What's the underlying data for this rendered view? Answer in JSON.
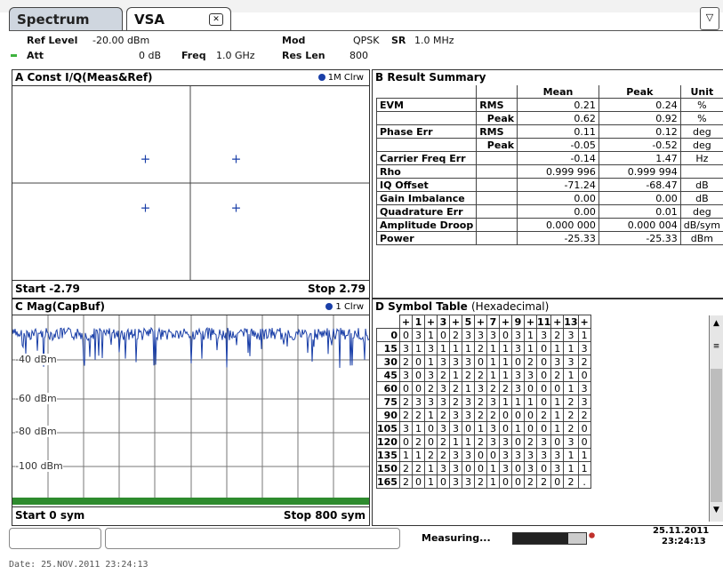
{
  "tabs": {
    "spectrum": "Spectrum",
    "vsa": "VSA"
  },
  "header": {
    "ref_level_label": "Ref Level",
    "ref_level_value": "-20.00 dBm",
    "att_label": "Att",
    "att_value": "0 dB",
    "freq_label": "Freq",
    "freq_value": "1.0 GHz",
    "mod_label": "Mod",
    "mod_value": "QPSK",
    "sr_label": "SR",
    "sr_value": "1.0 MHz",
    "reslen_label": "Res Len",
    "reslen_value": "800"
  },
  "panel_a": {
    "title": "A Const I/Q(Meas&Ref)",
    "legend": "1M Clrw",
    "start": "Start -2.79",
    "stop": "Stop 2.79",
    "points": [
      [
        -0.71,
        0.71
      ],
      [
        0.71,
        0.71
      ],
      [
        -0.71,
        -0.71
      ],
      [
        0.71,
        -0.71
      ]
    ],
    "x_range": [
      -2.79,
      2.79
    ],
    "y_range": [
      -2.79,
      2.79
    ],
    "marker_color": "#1a3fa8"
  },
  "panel_b": {
    "title": "B Result Summary",
    "col_mean": "Mean",
    "col_peak": "Peak",
    "col_unit": "Unit",
    "rows": [
      {
        "group": "EVM",
        "sub": "RMS",
        "mean": "0.21",
        "peak": "0.24",
        "unit": "%"
      },
      {
        "group": "",
        "sub": "Peak",
        "mean": "0.62",
        "peak": "0.92",
        "unit": "%"
      },
      {
        "group": "Phase Err",
        "sub": "RMS",
        "mean": "0.11",
        "peak": "0.12",
        "unit": "deg"
      },
      {
        "group": "",
        "sub": "Peak",
        "mean": "-0.05",
        "peak": "-0.52",
        "unit": "deg"
      },
      {
        "group": "Carrier Freq Err",
        "sub": "",
        "mean": "-0.14",
        "peak": "1.47",
        "unit": "Hz"
      },
      {
        "group": "Rho",
        "sub": "",
        "mean": "0.999 996",
        "peak": "0.999 994",
        "unit": ""
      },
      {
        "group": "IQ Offset",
        "sub": "",
        "mean": "-71.24",
        "peak": "-68.47",
        "unit": "dB"
      },
      {
        "group": "Gain Imbalance",
        "sub": "",
        "mean": "0.00",
        "peak": "0.00",
        "unit": "dB"
      },
      {
        "group": "Quadrature Err",
        "sub": "",
        "mean": "0.00",
        "peak": "0.01",
        "unit": "deg"
      },
      {
        "group": "Amplitude Droop",
        "sub": "",
        "mean": "0.000 000",
        "peak": "0.000 004",
        "unit": "dB/sym"
      },
      {
        "group": "Power",
        "sub": "",
        "mean": "-25.33",
        "peak": "-25.33",
        "unit": "dBm"
      }
    ]
  },
  "panel_c": {
    "title": "C Mag(CapBuf)",
    "legend": "1 Clrw",
    "y_labels": [
      "-40 dBm",
      "-60 dBm",
      "-80 dBm",
      "-100 dBm"
    ],
    "start": "Start 0 sym",
    "stop": "Stop 800 sym",
    "trace_color": "#1a3fa8",
    "bar_color": "#2e8b2e"
  },
  "panel_d": {
    "title": "D Symbol Table",
    "subtitle": "(Hexadecimal)",
    "columns": [
      "+",
      "1",
      "+",
      "3",
      "+",
      "5",
      "+",
      "7",
      "+",
      "9",
      "+",
      "11",
      "+",
      "13",
      "+"
    ],
    "rows": [
      {
        "offset": "0",
        "vals": [
          "0",
          "3",
          "1",
          "0",
          "2",
          "3",
          "3",
          "3",
          "0",
          "3",
          "1",
          "3",
          "2",
          "3",
          "1"
        ]
      },
      {
        "offset": "15",
        "vals": [
          "3",
          "1",
          "3",
          "1",
          "1",
          "1",
          "2",
          "1",
          "1",
          "3",
          "1",
          "0",
          "1",
          "1",
          "3"
        ]
      },
      {
        "offset": "30",
        "vals": [
          "2",
          "0",
          "1",
          "3",
          "3",
          "3",
          "0",
          "1",
          "1",
          "0",
          "2",
          "0",
          "3",
          "3",
          "2"
        ]
      },
      {
        "offset": "45",
        "vals": [
          "3",
          "0",
          "3",
          "2",
          "1",
          "2",
          "2",
          "1",
          "1",
          "3",
          "3",
          "0",
          "2",
          "1",
          "0"
        ]
      },
      {
        "offset": "60",
        "vals": [
          "0",
          "0",
          "2",
          "3",
          "2",
          "1",
          "3",
          "2",
          "2",
          "3",
          "0",
          "0",
          "0",
          "1",
          "3"
        ]
      },
      {
        "offset": "75",
        "vals": [
          "2",
          "3",
          "3",
          "3",
          "2",
          "3",
          "2",
          "3",
          "1",
          "1",
          "1",
          "0",
          "1",
          "2",
          "3"
        ]
      },
      {
        "offset": "90",
        "vals": [
          "2",
          "2",
          "1",
          "2",
          "3",
          "3",
          "2",
          "2",
          "0",
          "0",
          "0",
          "2",
          "1",
          "2",
          "2"
        ]
      },
      {
        "offset": "105",
        "vals": [
          "3",
          "1",
          "0",
          "3",
          "3",
          "0",
          "1",
          "3",
          "0",
          "1",
          "0",
          "0",
          "1",
          "2",
          "0"
        ]
      },
      {
        "offset": "120",
        "vals": [
          "0",
          "2",
          "0",
          "2",
          "1",
          "1",
          "2",
          "3",
          "3",
          "0",
          "2",
          "3",
          "0",
          "3",
          "0"
        ]
      },
      {
        "offset": "135",
        "vals": [
          "1",
          "1",
          "2",
          "2",
          "3",
          "3",
          "0",
          "0",
          "3",
          "3",
          "3",
          "3",
          "3",
          "1",
          "1"
        ]
      },
      {
        "offset": "150",
        "vals": [
          "2",
          "2",
          "1",
          "3",
          "3",
          "0",
          "0",
          "1",
          "3",
          "0",
          "3",
          "0",
          "3",
          "1",
          "1"
        ]
      },
      {
        "offset": "165",
        "vals": [
          "2",
          "0",
          "1",
          "0",
          "3",
          "3",
          "2",
          "1",
          "0",
          "0",
          "2",
          "2",
          "0",
          "2",
          "."
        ]
      }
    ]
  },
  "status": {
    "measuring": "Measuring...",
    "date": "25.11.2011",
    "time": "23:24:13",
    "progress_fraction": 0.75
  },
  "footer": {
    "text": "Date: 25.NOV.2011  23:24:13"
  }
}
